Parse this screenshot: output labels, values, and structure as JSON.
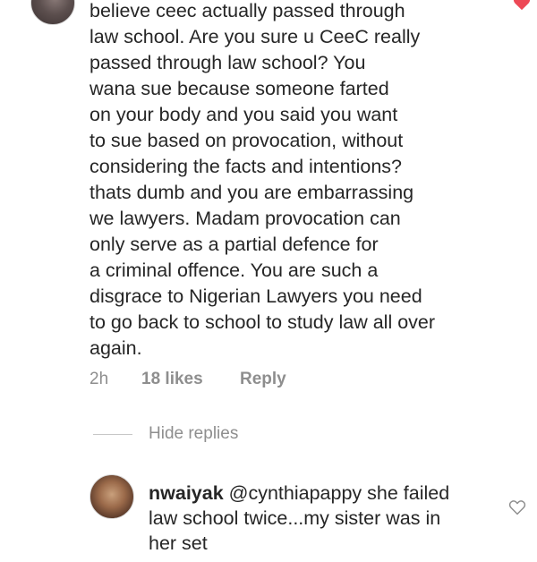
{
  "comment": {
    "lines": [
      "believe ceec actually passed through",
      "law school. Are you sure u CeeC really",
      "passed through  law school? You",
      "wana sue because someone farted",
      "on your body and you said you want",
      "to sue based on provocation, without",
      "considering the facts and intentions?",
      "thats dumb and you are embarrassing",
      "we lawyers. Madam provocation can",
      "only serve as a partial defence for",
      "a criminal offence. You are such a",
      "disgrace to Nigerian Lawyers you need",
      "to go back to school to study law all over",
      "again."
    ],
    "time": "2h",
    "likes": "18 likes",
    "reply_label": "Reply"
  },
  "hide_replies_label": "Hide replies",
  "reply": {
    "username": "nwaiyak",
    "line1_rest": " @cynthiapappy she failed",
    "line2": "law school twice...my sister was in",
    "line3": "her set"
  },
  "icons": {
    "top_heart": "heart-filled-icon",
    "reply_heart": "heart-outline-icon"
  },
  "colors": {
    "text": "#262626",
    "meta": "#8e8e8e",
    "heart_liked": "#ed4956"
  }
}
